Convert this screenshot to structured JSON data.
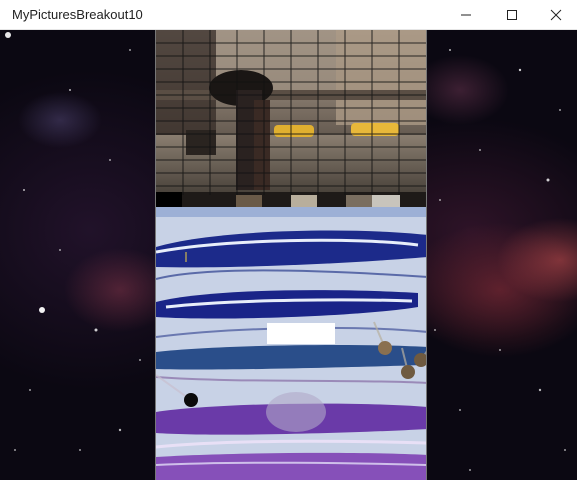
{
  "window": {
    "title": "MyPicturesBreakout10",
    "buttons": [
      "minimize-icon",
      "maximize-icon",
      "close-icon"
    ]
  },
  "game": {
    "paddle_color": "#ffffff",
    "balls": [
      {
        "name": "ball-black",
        "color": "#0a0a0a"
      },
      {
        "name": "ball-brown-1",
        "color": "#8a7050"
      },
      {
        "name": "ball-brown-2",
        "color": "#6f5a40"
      },
      {
        "name": "ball-brown-3",
        "color": "#6f5a40"
      }
    ]
  }
}
